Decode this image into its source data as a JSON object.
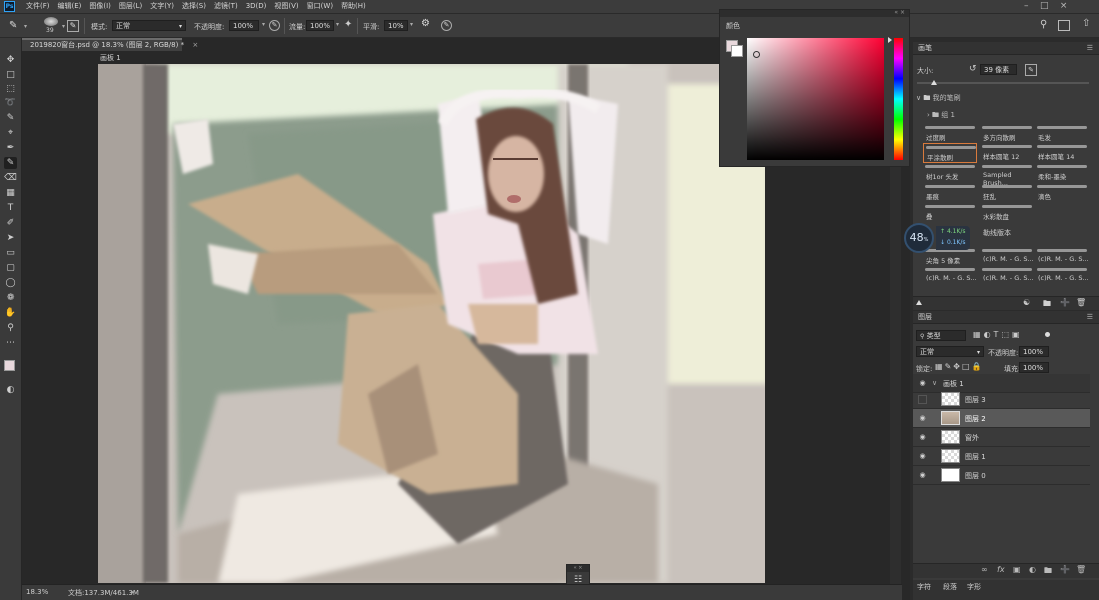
{
  "menubar": {
    "logo": "Ps",
    "items": [
      "文件(F)",
      "编辑(E)",
      "图像(I)",
      "图层(L)",
      "文字(Y)",
      "选择(S)",
      "滤镜(T)",
      "3D(D)",
      "视图(V)",
      "窗口(W)",
      "帮助(H)"
    ]
  },
  "options": {
    "brush_size": "39",
    "mode_label": "模式:",
    "mode_value": "正常",
    "opacity_label": "不透明度:",
    "opacity_value": "100%",
    "flow_label": "流量:",
    "flow_value": "100%",
    "smooth_label": "平滑:",
    "smooth_value": "10%"
  },
  "document": {
    "tab_title": "2019820窗台.psd @ 18.3% (图层 2, RGB/8) *",
    "tab_close": "×",
    "artboard_label": "画板 1",
    "status_zoom": "18.3%",
    "status_doc": "文档:137.3M/461.3M"
  },
  "color_panel": {
    "title": "颜色",
    "fg_color": "#e8d8dc",
    "hue_color": "#ff0033"
  },
  "brush_panel": {
    "title": "画笔",
    "size_label": "大小:",
    "size_value": "39 像素",
    "folder": "我的笔刷",
    "group": "组 1",
    "brushes": [
      [
        "过度刷",
        "多方向散刷",
        "毛发"
      ],
      [
        "平涂散刷",
        "样本圆笔 12",
        "样本圆笔 14"
      ],
      [
        "树1or 头发",
        "Sampled Brush...",
        "柔和-墨染"
      ],
      [
        "墨痕",
        "狂乱",
        "滴色"
      ],
      [
        "叠",
        "水彩散盘",
        ""
      ],
      [
        "尖角 5 像素",
        "(c)R. M. - G. S...",
        "(c)R. M. - G. S..."
      ],
      [
        "(c)R. M. - G. S...",
        "(c)R. M. - G. S...",
        "(c)R. M. - G. S..."
      ]
    ],
    "line_text": "勒线版本"
  },
  "overlay": {
    "cpu": "48",
    "cpu_unit": "%",
    "up": "4.1K/s",
    "down": "0.1K/s"
  },
  "layers_panel": {
    "title": "图层",
    "filter_label": "类型",
    "blend_mode": "正常",
    "opacity_label": "不透明度:",
    "opacity_value": "100%",
    "lock_label": "锁定:",
    "fill_label": "填充:",
    "fill_value": "100%",
    "layers": [
      {
        "name": "画板 1",
        "type": "group"
      },
      {
        "name": "图层 3",
        "visible": false
      },
      {
        "name": "图层 2",
        "visible": true,
        "selected": true
      },
      {
        "name": "窗外",
        "visible": true
      },
      {
        "name": "图层 1",
        "visible": true
      },
      {
        "name": "图层 0",
        "visible": true
      }
    ]
  },
  "bottom_tabs": [
    "字符",
    "段落",
    "字形"
  ]
}
